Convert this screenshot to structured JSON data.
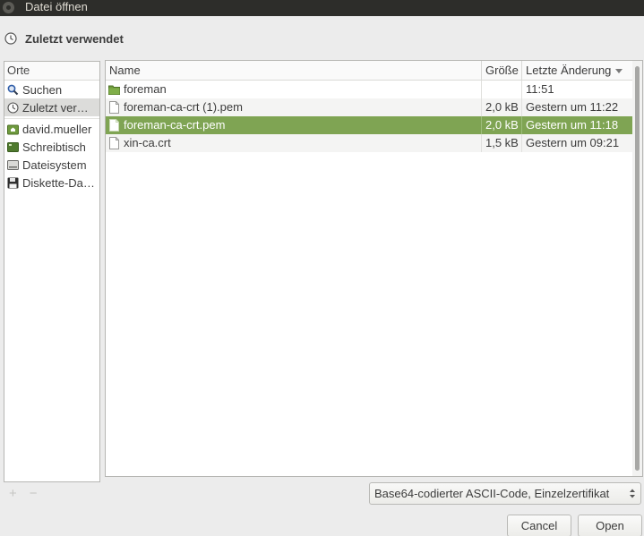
{
  "window": {
    "title": "Datei öffnen"
  },
  "location": {
    "label": "Zuletzt verwendet",
    "icon": "recent-clock-icon"
  },
  "places": {
    "header": "Orte",
    "items": [
      {
        "label": "Suchen",
        "icon": "search-icon"
      },
      {
        "label": "Zuletzt ver…",
        "icon": "recent-clock-icon",
        "active": true
      },
      {
        "label": "david.mueller",
        "icon": "home-folder-icon"
      },
      {
        "label": "Schreibtisch",
        "icon": "desktop-icon"
      },
      {
        "label": "Dateisystem",
        "icon": "harddisk-icon"
      },
      {
        "label": "Diskette-Da…",
        "icon": "floppy-icon"
      }
    ],
    "add_label": "+",
    "remove_label": "−"
  },
  "columns": {
    "name": "Name",
    "size": "Größe",
    "modified": "Letzte Änderung"
  },
  "files": [
    {
      "name": "foreman",
      "size": "",
      "modified": "11:51",
      "type": "folder"
    },
    {
      "name": "foreman-ca-crt (1).pem",
      "size": "2,0 kB",
      "modified": "Gestern um 11:22",
      "type": "file"
    },
    {
      "name": "foreman-ca-crt.pem",
      "size": "2,0 kB",
      "modified": "Gestern um 11:18",
      "type": "file",
      "selected": true
    },
    {
      "name": "xin-ca.crt",
      "size": "1,5 kB",
      "modified": "Gestern um 09:21",
      "type": "file"
    }
  ],
  "filter": {
    "selected": "Base64-codierter ASCII-Code, Einzelzertifikat"
  },
  "buttons": {
    "cancel": "Cancel",
    "open": "Open"
  },
  "colors": {
    "selection": "#7fa453",
    "titlebar": "#2d2d2a"
  }
}
